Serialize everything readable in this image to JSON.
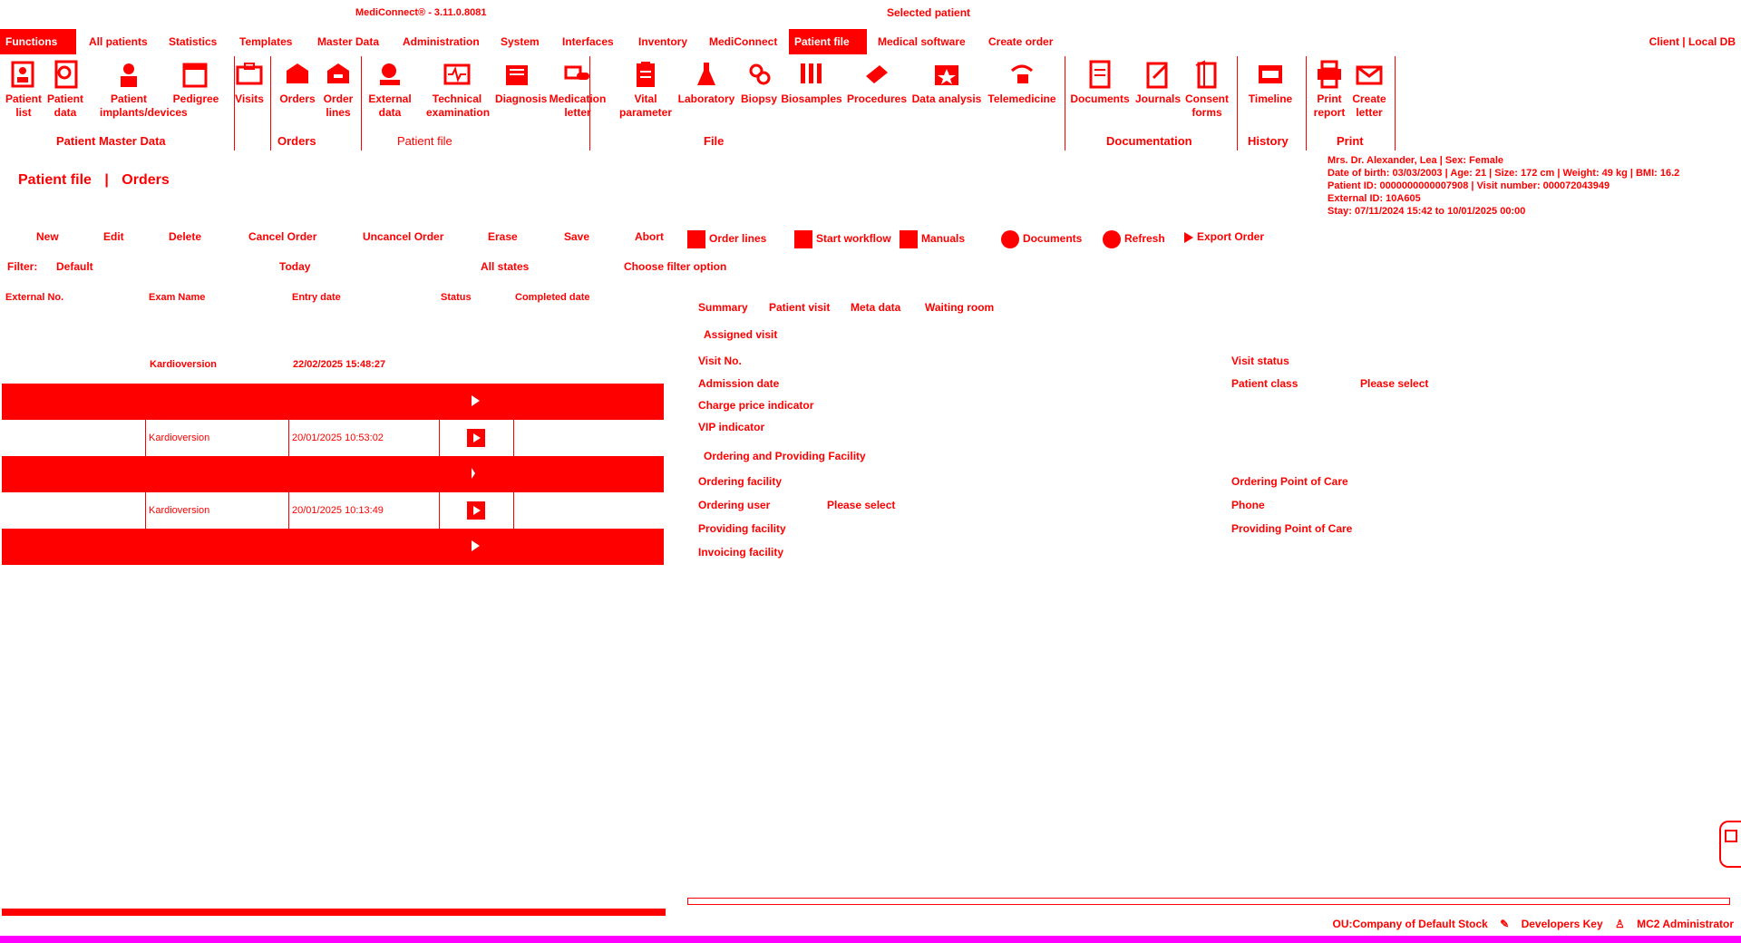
{
  "window": {
    "app_title": "MediConnect® - 3.11.0.8081",
    "selected_patient_title": "Selected patient"
  },
  "menubar": {
    "items": [
      {
        "label": "Functions",
        "active": true
      },
      {
        "label": "All patients",
        "active": false
      },
      {
        "label": "Statistics",
        "active": false
      },
      {
        "label": "Templates",
        "active": false
      },
      {
        "label": "Master Data",
        "active": false
      },
      {
        "label": "Administration",
        "active": false
      },
      {
        "label": "System",
        "active": false
      },
      {
        "label": "Interfaces",
        "active": false
      },
      {
        "label": "Inventory",
        "active": false
      },
      {
        "label": "MediConnect",
        "active": false
      },
      {
        "label": "Patient file",
        "active": true
      },
      {
        "label": "Medical software",
        "active": false
      },
      {
        "label": "Create order",
        "active": false
      }
    ],
    "client": "Client | Local DB"
  },
  "ribbon": {
    "buttons": [
      {
        "label": "Patient list"
      },
      {
        "label": "Patient data"
      },
      {
        "label": "Patient implants/devices"
      },
      {
        "label": "Pedigree"
      },
      {
        "label": "Visits"
      },
      {
        "label": "Orders"
      },
      {
        "label": "Order lines"
      },
      {
        "label": "External data"
      },
      {
        "label": "Technical examination"
      },
      {
        "label": "Diagnosis"
      },
      {
        "label": "Medication letter"
      },
      {
        "label": "Vital parameter"
      },
      {
        "label": "Laboratory"
      },
      {
        "label": "Biopsy"
      },
      {
        "label": "Biosamples"
      },
      {
        "label": "Procedures"
      },
      {
        "label": "Data analysis"
      },
      {
        "label": "Telemedicine"
      },
      {
        "label": "Documents"
      },
      {
        "label": "Journals"
      },
      {
        "label": "Consent forms"
      },
      {
        "label": "Timeline"
      },
      {
        "label": "Print report"
      },
      {
        "label": "Create letter"
      }
    ],
    "groups": [
      "Patient Master Data",
      "Orders",
      "Patient file",
      "File",
      "Documentation",
      "History",
      "Print"
    ]
  },
  "patient": {
    "line1": "Mrs. Dr. Alexander, Lea | Sex: Female",
    "line2": "Date of birth: 03/03/2003 | Age: 21 | Size: 172 cm | Weight: 49 kg | BMI: 16.2",
    "line3": "Patient ID: 0000000000007908 | Visit number: 000072043949",
    "line4": "External ID: 10A605",
    "line5": "Stay: 07/11/2024 15:42 to 10/01/2025 00:00"
  },
  "breadcrumb": {
    "part1": "Patient file",
    "separator": "|",
    "part2": "Orders"
  },
  "toolbar": {
    "new": "New",
    "edit": "Edit",
    "delete": "Delete",
    "cancel_order": "Cancel Order",
    "uncancel_order": "Uncancel Order",
    "erase": "Erase",
    "save": "Save",
    "abort": "Abort",
    "order_lines": "Order lines",
    "start_workflow": "Start workflow",
    "manuals": "Manuals",
    "documents": "Documents",
    "refresh": "Refresh",
    "export_order": "Export Order"
  },
  "filter": {
    "label": "Filter:",
    "value": "Default",
    "date": "Today",
    "status": "All states",
    "option": "Choose filter option"
  },
  "table": {
    "headers": [
      "External No.",
      "Exam Name",
      "Entry date",
      "Status",
      "Completed date"
    ],
    "rows": [
      {
        "exam": "Kardioversion",
        "entry": "22/02/2025 15:48:27"
      },
      {
        "exam": "Kardioversion",
        "entry": "20/01/2025 10:53:02"
      },
      {
        "exam": "Kardioversion",
        "entry": "20/01/2025 10:13:49"
      }
    ]
  },
  "detail": {
    "tabs": [
      "Summary",
      "Patient visit",
      "Meta data",
      "Waiting room"
    ],
    "section_visit": "Assigned visit",
    "visit_no": "Visit No.",
    "admission_date": "Admission date",
    "charge_price": "Charge price indicator",
    "vip": "VIP indicator",
    "visit_status": "Visit status",
    "patient_class": "Patient class",
    "please_select": "Please select",
    "section_facility": "Ordering and Providing Facility",
    "ordering_facility": "Ordering facility",
    "ordering_user": "Ordering user",
    "providing_facility": "Providing facility",
    "invoicing_facility": "Invoicing facility",
    "ordering_poc": "Ordering Point of Care",
    "phone": "Phone",
    "providing_poc": "Providing Point of Care"
  },
  "status": {
    "org": "OU:Company of Default Stock",
    "key": "Developers Key",
    "user": "MC2 Administrator"
  }
}
